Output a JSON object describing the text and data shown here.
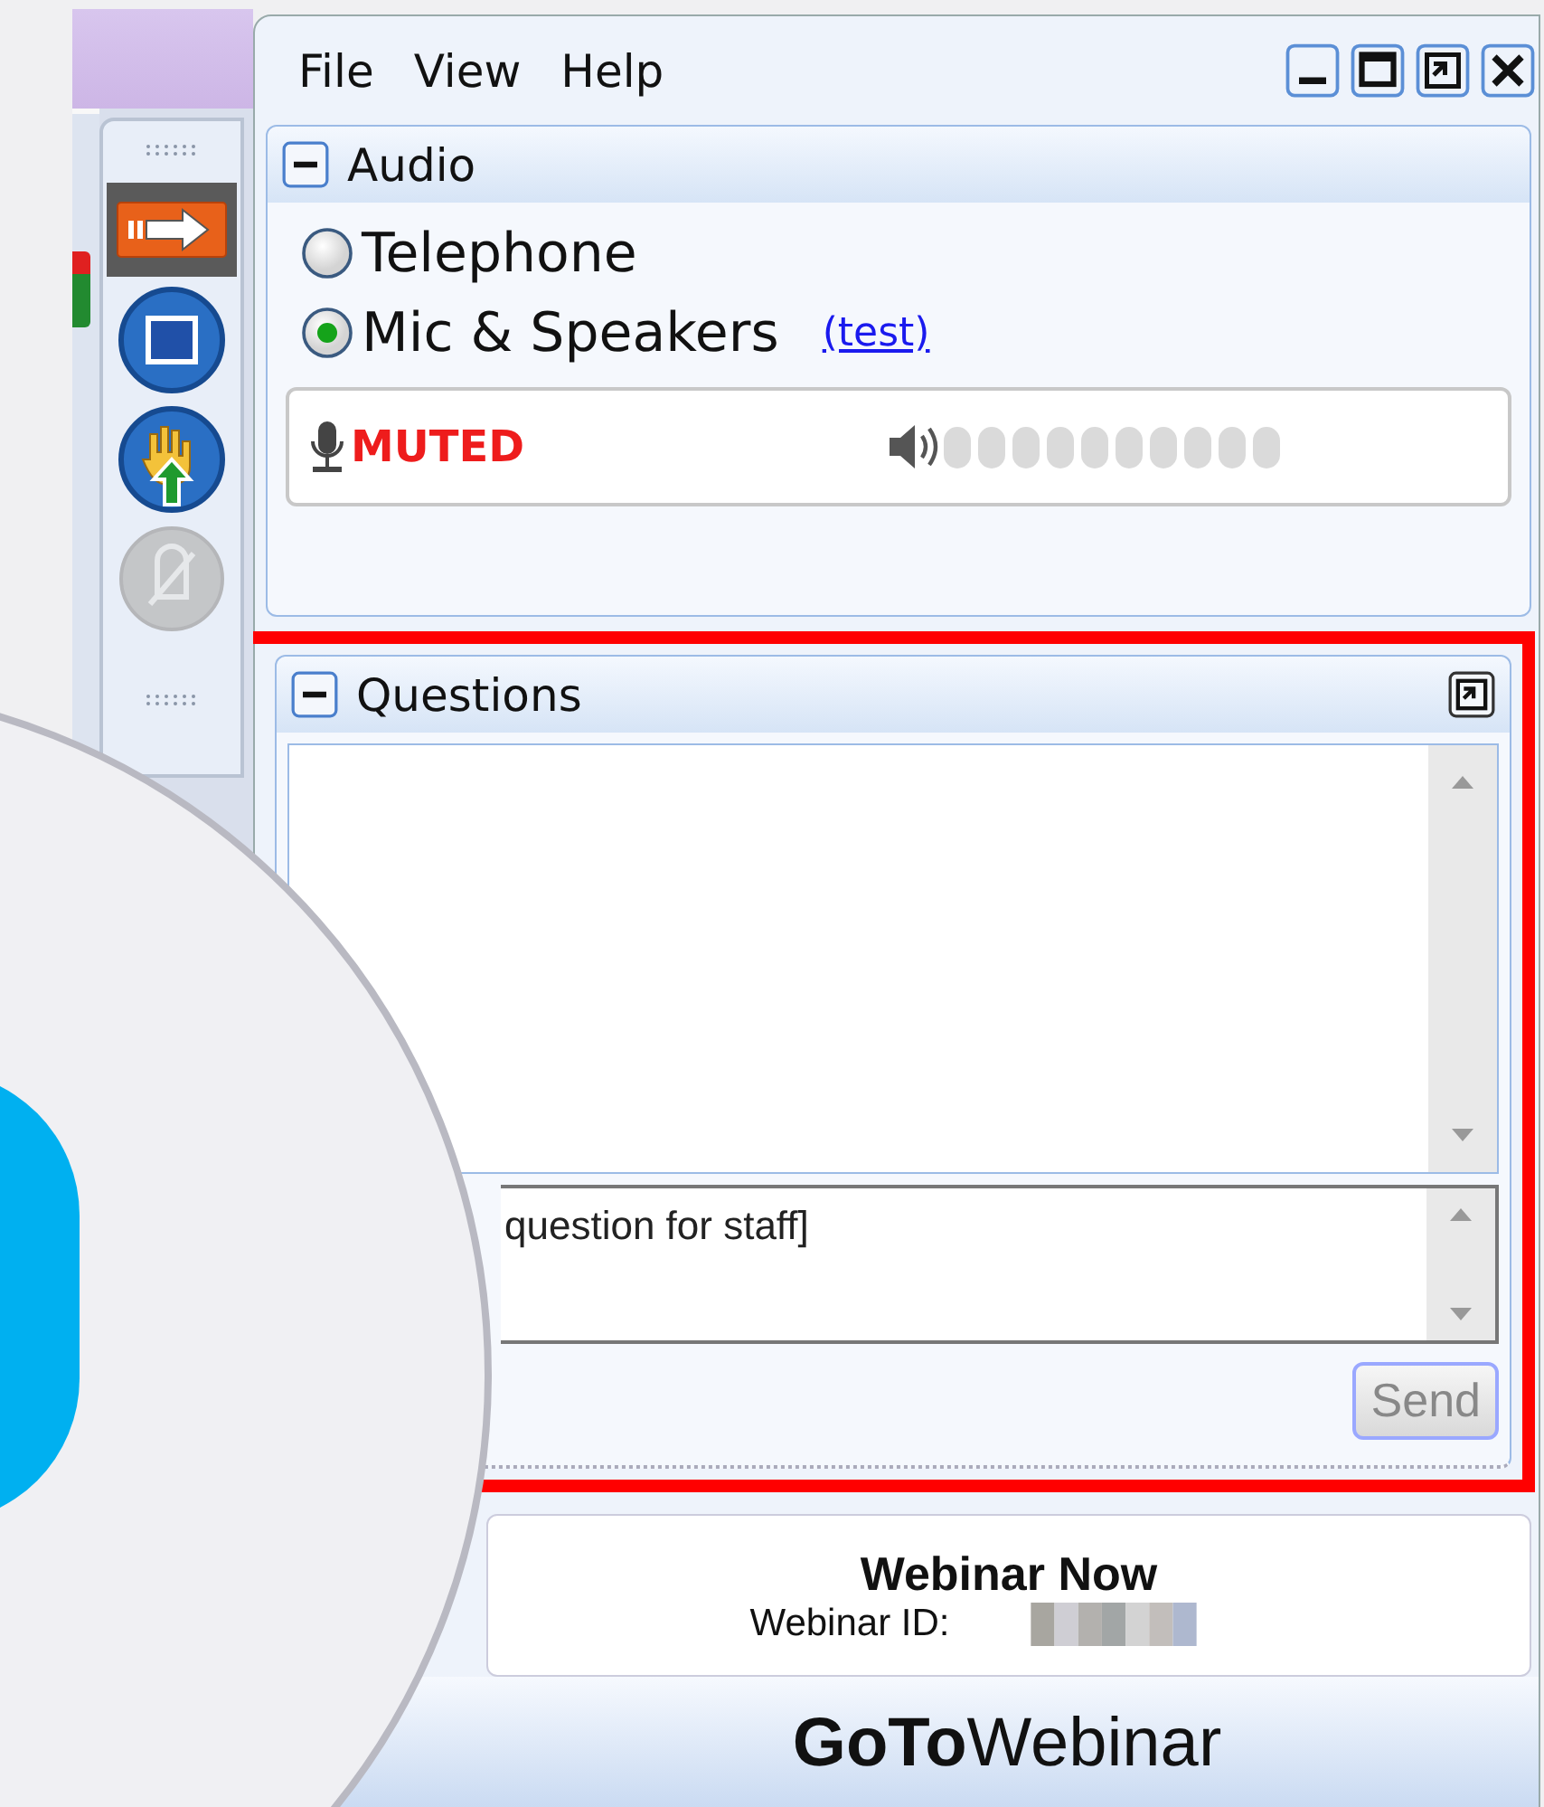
{
  "toolbar": {
    "items": [
      {
        "kind": "arrow",
        "selected": true,
        "disabled": false
      },
      {
        "kind": "screen",
        "selected": false,
        "disabled": false
      },
      {
        "kind": "hand",
        "selected": false,
        "disabled": false
      },
      {
        "kind": "mic_off",
        "selected": false,
        "disabled": true
      }
    ]
  },
  "menu": [
    {
      "label": "File"
    },
    {
      "label": "View"
    },
    {
      "label": "Help"
    }
  ],
  "audio": {
    "title": "Audio",
    "expanded": true,
    "options": [
      {
        "label": "Telephone",
        "selected": false
      },
      {
        "label": "Mic & Speakers",
        "selected": true
      }
    ],
    "test_link": "(test)",
    "mic_status": "MUTED"
  },
  "questions": {
    "title": "Questions",
    "expanded": true,
    "highlighted": true,
    "input_value": "question for staff]",
    "send": {
      "label": "Send",
      "disabled": true
    }
  },
  "session": {
    "title": "Webinar Now",
    "id_label": "Webinar ID:"
  },
  "brand": {
    "bold": "GoTo",
    "light": "Webinar"
  }
}
